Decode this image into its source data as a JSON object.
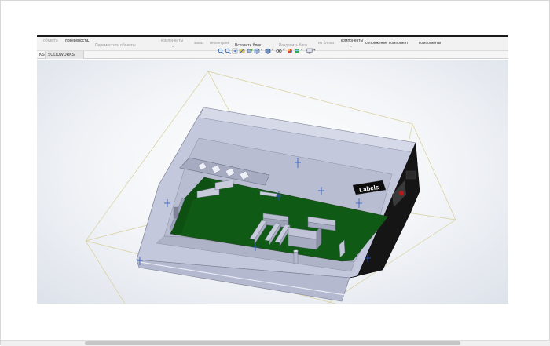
{
  "ribbon": {
    "items": [
      "объекта",
      "поверхности",
      "Переместить объекты",
      "компоненты",
      "заказ",
      "геометрии",
      "Вставить блок",
      "Разделить блок",
      "из блока",
      "компоненты",
      "сопряжение",
      "компонент",
      "компоненты"
    ]
  },
  "tabs": [
    {
      "label": "KS"
    },
    {
      "label": "SOLIDWORKS MBD"
    }
  ],
  "viewport": {
    "model_label": "Labels",
    "pcb_color": "#0f5a14",
    "housing_color": "#c4c8dc",
    "connector_color": "#151515",
    "bbox_color": "#d8cf9a"
  },
  "icons": [
    "zoom-to-fit-icon",
    "zoom-area-icon",
    "previous-view-icon",
    "section-view-icon",
    "dynamic-annotation-icon",
    "view-orientation-icon",
    "display-style-icon",
    "hide-show-items-icon",
    "edit-appearance-icon",
    "apply-scene-icon",
    "view-settings-icon",
    "monitor-icon"
  ]
}
